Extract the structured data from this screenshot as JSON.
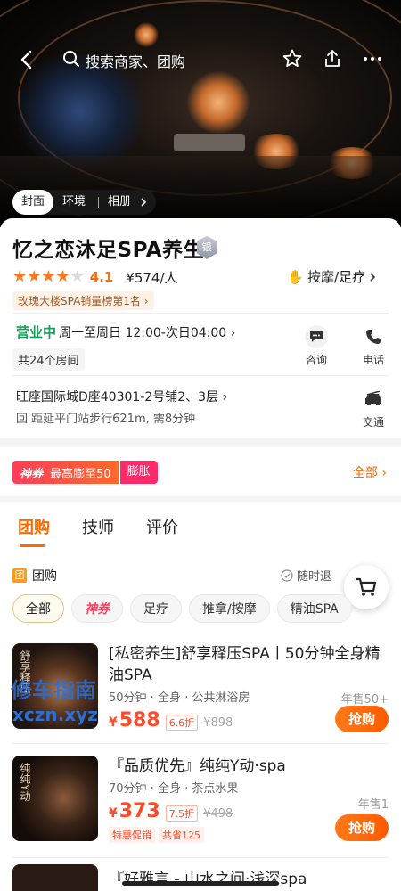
{
  "header": {
    "search_placeholder": "搜索商家、团购",
    "hero_tabs": [
      "封面",
      "环境",
      "相册"
    ]
  },
  "shop": {
    "name": "忆之恋沐足SPA养生",
    "badge": "银",
    "rating": "4.1",
    "rating_value": 4.1,
    "price": "¥574/人",
    "category": "按摩/足疗",
    "rank_tag": "玫瑰大楼SPA销量榜第1名",
    "status": "营业中",
    "hours": "周一至周日 12:00-次日04:00",
    "rooms": "共24个房间",
    "address": "旺座国际城D座40301-2号铺2、3层",
    "metro": "距延平门站步行621m, 需8分钟",
    "actions": [
      "咨询",
      "电话",
      "交通"
    ]
  },
  "promo": {
    "brand": "神券",
    "text": "最高膨至50",
    "tag": "膨胀",
    "all": "全部"
  },
  "tabs": [
    "团购",
    "技师",
    "评价"
  ],
  "group_buy": {
    "header": "团购",
    "refund": "随时退",
    "filters": [
      "全部",
      "神券",
      "足疗",
      "推拿/按摩",
      "精油SPA"
    ]
  },
  "deals": [
    {
      "thumb_text": "舒享释压",
      "title": "[私密养生]舒享释压SPA丨50分钟全身精油SPA",
      "meta": "50分钟 · 全身 · 公共淋浴房",
      "sold": "年售50+",
      "currency": "¥",
      "price": "588",
      "discount": "6.6折",
      "original": "¥898",
      "button": "抢购"
    },
    {
      "thumb_text": "纯纯Y动",
      "title": "『品质优先』纯纯Y动·spa",
      "meta": "70分钟 · 全身 · 茶点水果",
      "sold": "年售1",
      "currency": "¥",
      "price": "373",
      "discount": "7.5折",
      "original": "¥498",
      "tags": [
        "特惠促销",
        "共省125"
      ],
      "button": "抢购"
    }
  ],
  "third_deal_title": "『好雅言 - 山水之间·浅深spa",
  "watermark": {
    "line1": "修车指南",
    "line2": "xczn.xyz"
  },
  "colors": {
    "accent": "#ff6a00",
    "open": "#1aa05a",
    "price": "#ff4a2a"
  }
}
